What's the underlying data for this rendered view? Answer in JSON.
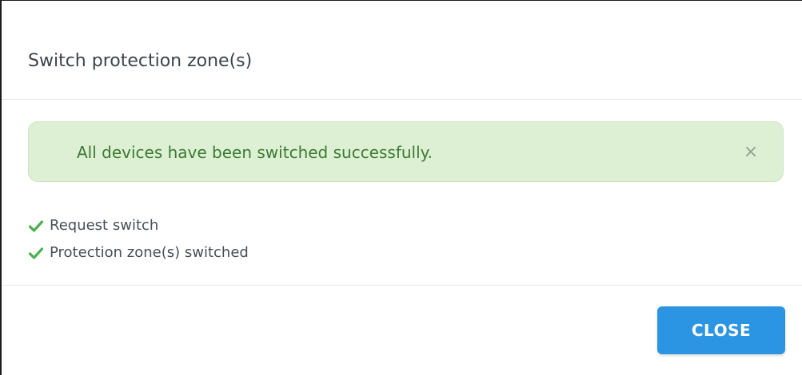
{
  "dialog": {
    "title": "Switch protection zone(s)"
  },
  "alert": {
    "message": "All devices have been switched successfully.",
    "dismiss_symbol": "×",
    "status": "success",
    "background_color": "#ddf0d4",
    "text_color": "#3c7a34"
  },
  "steps": [
    {
      "label": "Request switch",
      "status": "done",
      "icon": "checkmark-icon"
    },
    {
      "label": "Protection zone(s) switched",
      "status": "done",
      "icon": "checkmark-icon"
    }
  ],
  "footer": {
    "close_label": "CLOSE"
  },
  "colors": {
    "check_green": "#4caf50",
    "button_blue": "#2c95e3"
  }
}
